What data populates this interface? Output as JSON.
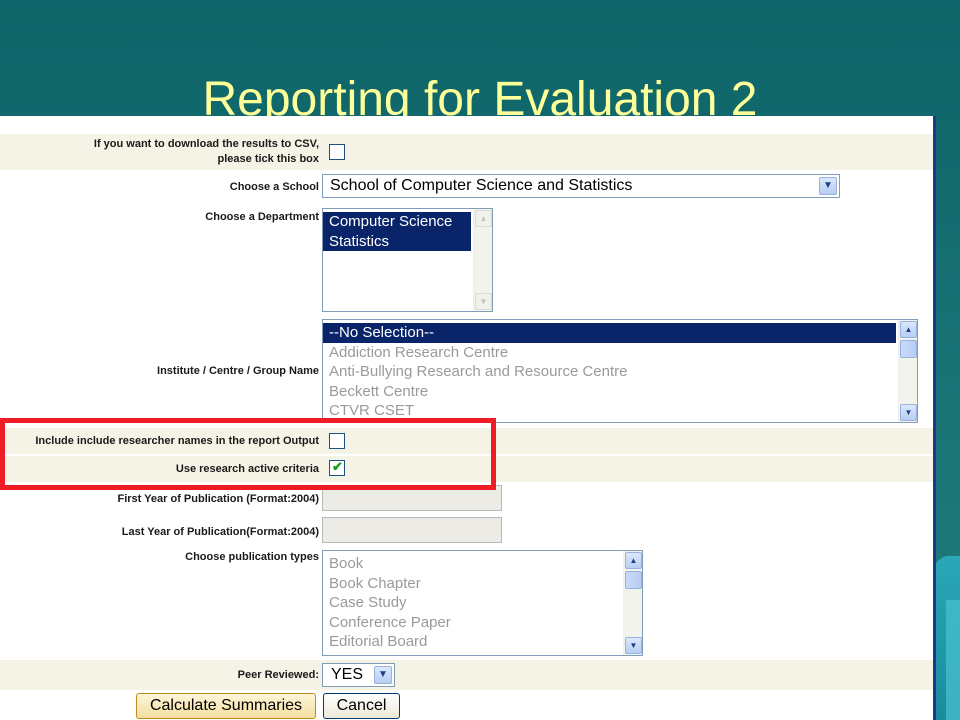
{
  "slide": {
    "title": "Reporting for Evaluation 2"
  },
  "form": {
    "csv": {
      "label_line1": "If you want to download the results to CSV,",
      "label_line2": "please tick this box",
      "checked": false
    },
    "school": {
      "label": "Choose a School",
      "selected": "School of Computer Science and Statistics"
    },
    "department": {
      "label": "Choose a Department",
      "options": [
        "Computer Science",
        "Statistics"
      ]
    },
    "institute": {
      "label": "Institute / Centre / Group Name",
      "options": [
        "--No Selection--",
        "Addiction Research Centre",
        "Anti-Bullying Research and Resource Centre",
        "Beckett Centre",
        "CTVR CSET"
      ]
    },
    "researcher_names": {
      "label": "Include include researcher names in the report Output",
      "checked": false
    },
    "research_active": {
      "label": "Use research active criteria",
      "checked": true
    },
    "first_year": {
      "label": "First Year of Publication (Format:2004)",
      "value": ""
    },
    "last_year": {
      "label": "Last Year of Publication(Format:2004)",
      "value": ""
    },
    "pub_types": {
      "label": "Choose publication types",
      "options": [
        "Book",
        "Book Chapter",
        "Case Study",
        "Conference Paper",
        "Editorial Board"
      ]
    },
    "peer_reviewed": {
      "label": "Peer Reviewed:",
      "selected": "YES"
    },
    "buttons": {
      "calculate": "Calculate Summaries",
      "cancel": "Cancel"
    }
  },
  "colors": {
    "background": "#166f72",
    "title": "#ffff99",
    "highlight": "#ee1c24",
    "selection": "#0a246a"
  }
}
